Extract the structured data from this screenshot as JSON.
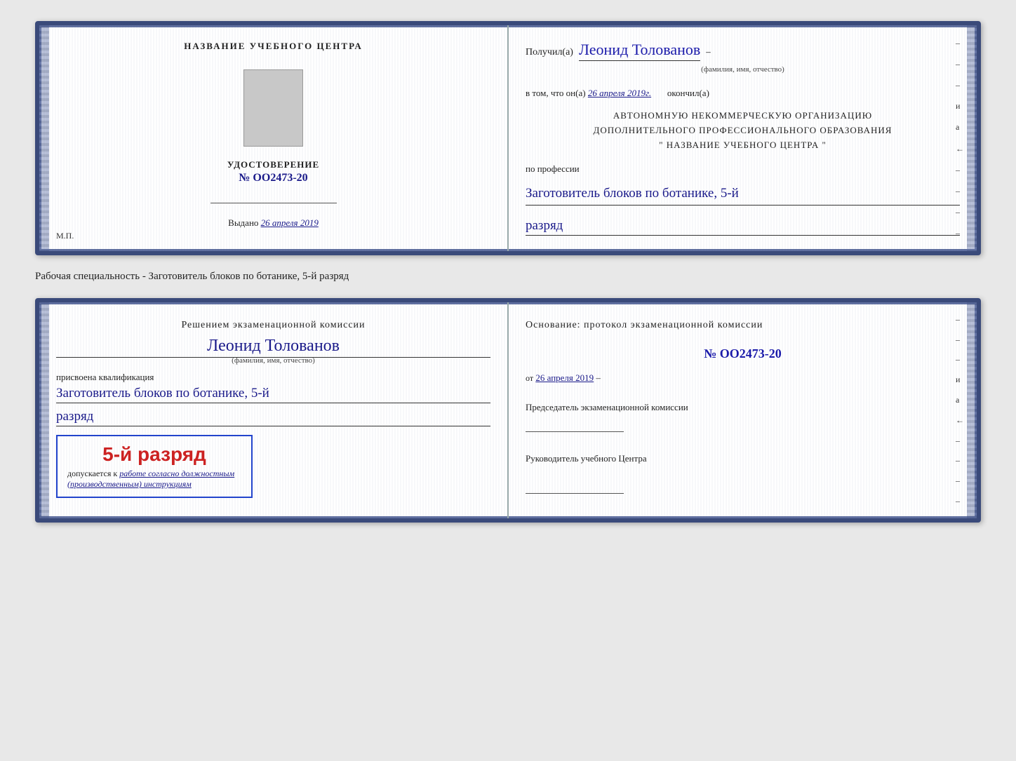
{
  "top_card": {
    "left": {
      "center_title": "НАЗВАНИЕ УЧЕБНОГО ЦЕНТРА",
      "udost_title": "УДОСТОВЕРЕНИЕ",
      "udost_number": "№ OO2473-20",
      "vydano_label": "Выдано",
      "vydano_date": "26 апреля 2019",
      "mp_label": "М.П."
    },
    "right": {
      "poluchil_label": "Получил(a)",
      "fio_value": "Леонид Толованов",
      "fio_hint": "(фамилия, имя, отчество)",
      "vtom_label": "в том, что он(а)",
      "vtom_date": "26 апреля 2019г.",
      "okonchil_label": "окончил(а)",
      "org_line1": "АВТОНОМНУЮ НЕКОММЕРЧЕСКУЮ ОРГАНИЗАЦИЮ",
      "org_line2": "ДОПОЛНИТЕЛЬНОГО ПРОФЕССИОНАЛЬНОГО ОБРАЗОВАНИЯ",
      "org_name": "\" НАЗВАНИЕ УЧЕБНОГО ЦЕНТРА \"",
      "po_professii_label": "по профессии",
      "profession": "Заготовитель блоков по ботанике, 5-й",
      "razryad": "разряд"
    }
  },
  "middle_label": "Рабочая специальность - Заготовитель блоков по ботанике, 5-й разряд",
  "bottom_card": {
    "left": {
      "resheniem_line1": "Решением экзаменационной комиссии",
      "fio_value": "Леонид Толованов",
      "fio_hint": "(фамилия, имя, отчество)",
      "prisvoena_label": "присвоена квалификация",
      "kvalif": "Заготовитель блоков по ботанике, 5-й",
      "razryad": "разряд",
      "stamp_text": "5-й разряд",
      "dopuskaetsya_label": "допускается к",
      "dopuskaetsya_italic": "работе согласно должностным (производственным) инструкциям"
    },
    "right": {
      "osnovanie_label": "Основание: протокол экзаменационной комиссии",
      "protocol_number": "№ OO2473-20",
      "ot_label": "от",
      "ot_date": "26 апреля 2019",
      "predsedatel_title": "Председатель экзаменационной комиссии",
      "rukovoditel_title": "Руководитель учебного Центра"
    }
  },
  "right_marks": [
    "–",
    "–",
    "–",
    "и",
    "а",
    "←",
    "–",
    "–",
    "–",
    "–"
  ]
}
